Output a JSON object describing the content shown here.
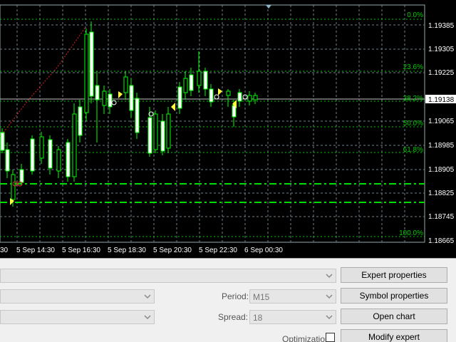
{
  "chart": {
    "price_labels": [
      "1.19385",
      "1.19305",
      "1.19225",
      "1.19138",
      "1.19065",
      "1.18985",
      "1.18905",
      "1.18825",
      "1.18745",
      "1.18665"
    ],
    "current_price": "1.19138",
    "time_labels": [
      "30",
      "5 Sep 14:30",
      "5 Sep 16:30",
      "5 Sep 18:30",
      "5 Sep 20:30",
      "5 Sep 22:30",
      "6 Sep 00:30"
    ],
    "fib_labels": [
      "0.0%",
      "23.6%",
      "38.2%",
      "50.0%",
      "61.8%",
      "100.0%"
    ],
    "colors": {
      "grid": "#6b7f8a",
      "bull": "#00ff00",
      "fib": "#00c800",
      "current": "#c0c0c0"
    }
  },
  "tester": {
    "top_combo": "",
    "period_label": "Period:",
    "period_value": "M15",
    "spread_label": "Spread:",
    "spread_value": "18",
    "optimization_label": "Optimization",
    "buttons": {
      "expert_properties": "Expert properties",
      "symbol_properties": "Symbol properties",
      "open_chart": "Open chart",
      "modify_expert": "Modify expert"
    }
  }
}
